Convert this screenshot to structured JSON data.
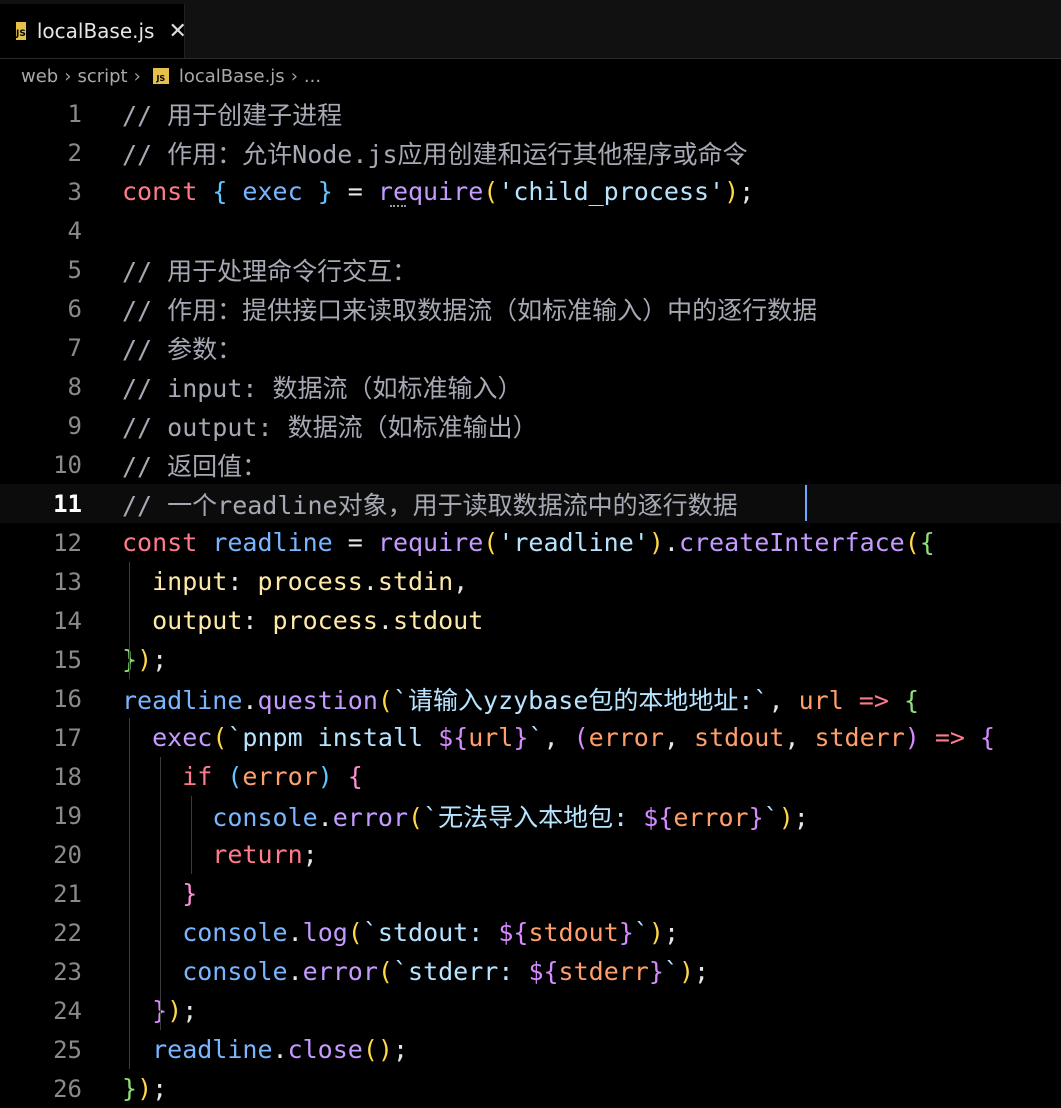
{
  "tab": {
    "icon": "js-file-icon",
    "icon_text": "JS",
    "label": "localBase.js",
    "close": "✕"
  },
  "breadcrumb": [
    "web",
    "script",
    "localBase.js",
    "..."
  ],
  "active_line": 11,
  "colors": {
    "comment": "#a6a9b3",
    "keyword": "#ff7b8c",
    "variable": "#7ab6ff",
    "property": "#ffe9a8",
    "string": "#b7e4ff",
    "function": "#c49bff",
    "punct": "#e6e6e6",
    "param": "#ff9f6b",
    "bracket1": "#ffd84a",
    "bracket2": "#d68bff",
    "bracket3": "#60c7ff",
    "bracket4": "#ff8fd8",
    "bracket_green": "#8fe07a"
  },
  "lines": [
    {
      "n": "1",
      "tokens": [
        [
          "// 用于创建子进程",
          "comment"
        ]
      ]
    },
    {
      "n": "2",
      "tokens": [
        [
          "// 作用：允许Node.js应用创建和运行其他程序或命令",
          "comment"
        ]
      ]
    },
    {
      "n": "3",
      "tokens": [
        [
          "const ",
          "keyword"
        ],
        [
          "{ ",
          "bracket3"
        ],
        [
          "exec",
          "variable"
        ],
        [
          " }",
          "bracket3"
        ],
        [
          " = ",
          "punct"
        ],
        [
          "require",
          "function"
        ],
        [
          "(",
          "bracket1"
        ],
        [
          "'child_process'",
          "string"
        ],
        [
          ")",
          "bracket1"
        ],
        [
          ";",
          "punct"
        ]
      ]
    },
    {
      "n": "4",
      "tokens": []
    },
    {
      "n": "5",
      "tokens": [
        [
          "// 用于处理命令行交互：",
          "comment"
        ]
      ]
    },
    {
      "n": "6",
      "tokens": [
        [
          "// 作用：提供接口来读取数据流（如标准输入）中的逐行数据",
          "comment"
        ]
      ]
    },
    {
      "n": "7",
      "tokens": [
        [
          "// 参数：",
          "comment"
        ]
      ]
    },
    {
      "n": "8",
      "tokens": [
        [
          "// input: 数据流（如标准输入）",
          "comment"
        ]
      ]
    },
    {
      "n": "9",
      "tokens": [
        [
          "// output: 数据流（如标准输出）",
          "comment"
        ]
      ]
    },
    {
      "n": "10",
      "tokens": [
        [
          "// 返回值：",
          "comment"
        ]
      ]
    },
    {
      "n": "11",
      "tokens": [
        [
          "// 一个readline对象，用于读取数据流中的逐行数据",
          "comment"
        ]
      ]
    },
    {
      "n": "12",
      "tokens": [
        [
          "const ",
          "keyword"
        ],
        [
          "readline",
          "variable"
        ],
        [
          " = ",
          "punct"
        ],
        [
          "require",
          "function"
        ],
        [
          "(",
          "bracket1"
        ],
        [
          "'readline'",
          "string"
        ],
        [
          ")",
          "bracket1"
        ],
        [
          ".",
          "punct"
        ],
        [
          "createInterface",
          "function"
        ],
        [
          "(",
          "bracket1"
        ],
        [
          "{",
          "bracket_green"
        ]
      ]
    },
    {
      "n": "13",
      "tokens": [
        [
          "  input",
          "property"
        ],
        [
          ": ",
          "punct"
        ],
        [
          "process",
          "property"
        ],
        [
          ".",
          "punct"
        ],
        [
          "stdin",
          "property"
        ],
        [
          ",",
          "punct"
        ]
      ]
    },
    {
      "n": "14",
      "tokens": [
        [
          "  output",
          "property"
        ],
        [
          ": ",
          "punct"
        ],
        [
          "process",
          "property"
        ],
        [
          ".",
          "punct"
        ],
        [
          "stdout",
          "property"
        ]
      ]
    },
    {
      "n": "15",
      "tokens": [
        [
          "}",
          "bracket_green"
        ],
        [
          ")",
          "bracket1"
        ],
        [
          ";",
          "punct"
        ]
      ]
    },
    {
      "n": "16",
      "tokens": [
        [
          "readline",
          "variable"
        ],
        [
          ".",
          "punct"
        ],
        [
          "question",
          "function"
        ],
        [
          "(",
          "bracket1"
        ],
        [
          "`请输入yzybase包的本地地址:`",
          "string"
        ],
        [
          ", ",
          "punct"
        ],
        [
          "url",
          "param"
        ],
        [
          " => ",
          "keyword"
        ],
        [
          "{",
          "bracket_green"
        ]
      ]
    },
    {
      "n": "17",
      "tokens": [
        [
          "  exec",
          "function"
        ],
        [
          "(",
          "bracket1"
        ],
        [
          "`pnpm install ",
          "string"
        ],
        [
          "${",
          "bracket2"
        ],
        [
          "url",
          "param"
        ],
        [
          "}",
          "bracket2"
        ],
        [
          "`",
          "string"
        ],
        [
          ", ",
          "punct"
        ],
        [
          "(",
          "bracket2"
        ],
        [
          "error",
          "param"
        ],
        [
          ", ",
          "punct"
        ],
        [
          "stdout",
          "param"
        ],
        [
          ", ",
          "punct"
        ],
        [
          "stderr",
          "param"
        ],
        [
          ")",
          "bracket2"
        ],
        [
          " => ",
          "keyword"
        ],
        [
          "{",
          "bracket2"
        ]
      ]
    },
    {
      "n": "18",
      "tokens": [
        [
          "    if ",
          "keyword"
        ],
        [
          "(",
          "bracket3"
        ],
        [
          "error",
          "param"
        ],
        [
          ")",
          "bracket3"
        ],
        [
          " {",
          "bracket4"
        ]
      ]
    },
    {
      "n": "19",
      "tokens": [
        [
          "      console",
          "variable"
        ],
        [
          ".",
          "punct"
        ],
        [
          "error",
          "function"
        ],
        [
          "(",
          "bracket1"
        ],
        [
          "`无法导入本地包: ",
          "string"
        ],
        [
          "${",
          "bracket2"
        ],
        [
          "error",
          "param"
        ],
        [
          "}",
          "bracket2"
        ],
        [
          "`",
          "string"
        ],
        [
          ")",
          "bracket1"
        ],
        [
          ";",
          "punct"
        ]
      ]
    },
    {
      "n": "20",
      "tokens": [
        [
          "      return",
          "keyword"
        ],
        [
          ";",
          "punct"
        ]
      ]
    },
    {
      "n": "21",
      "tokens": [
        [
          "    }",
          "bracket4"
        ]
      ]
    },
    {
      "n": "22",
      "tokens": [
        [
          "    console",
          "variable"
        ],
        [
          ".",
          "punct"
        ],
        [
          "log",
          "function"
        ],
        [
          "(",
          "bracket1"
        ],
        [
          "`stdout: ",
          "string"
        ],
        [
          "${",
          "bracket2"
        ],
        [
          "stdout",
          "param"
        ],
        [
          "}",
          "bracket2"
        ],
        [
          "`",
          "string"
        ],
        [
          ")",
          "bracket1"
        ],
        [
          ";",
          "punct"
        ]
      ]
    },
    {
      "n": "23",
      "tokens": [
        [
          "    console",
          "variable"
        ],
        [
          ".",
          "punct"
        ],
        [
          "error",
          "function"
        ],
        [
          "(",
          "bracket1"
        ],
        [
          "`stderr: ",
          "string"
        ],
        [
          "${",
          "bracket2"
        ],
        [
          "stderr",
          "param"
        ],
        [
          "}",
          "bracket2"
        ],
        [
          "`",
          "string"
        ],
        [
          ")",
          "bracket1"
        ],
        [
          ";",
          "punct"
        ]
      ]
    },
    {
      "n": "24",
      "tokens": [
        [
          "  }",
          "bracket2"
        ],
        [
          ")",
          "bracket1"
        ],
        [
          ";",
          "punct"
        ]
      ]
    },
    {
      "n": "25",
      "tokens": [
        [
          "  readline",
          "variable"
        ],
        [
          ".",
          "punct"
        ],
        [
          "close",
          "function"
        ],
        [
          "(",
          "bracket1"
        ],
        [
          ")",
          "bracket1"
        ],
        [
          ";",
          "punct"
        ]
      ]
    },
    {
      "n": "26",
      "tokens": [
        [
          "}",
          "bracket_green"
        ],
        [
          ")",
          "bracket1"
        ],
        [
          ";",
          "punct"
        ]
      ]
    }
  ]
}
